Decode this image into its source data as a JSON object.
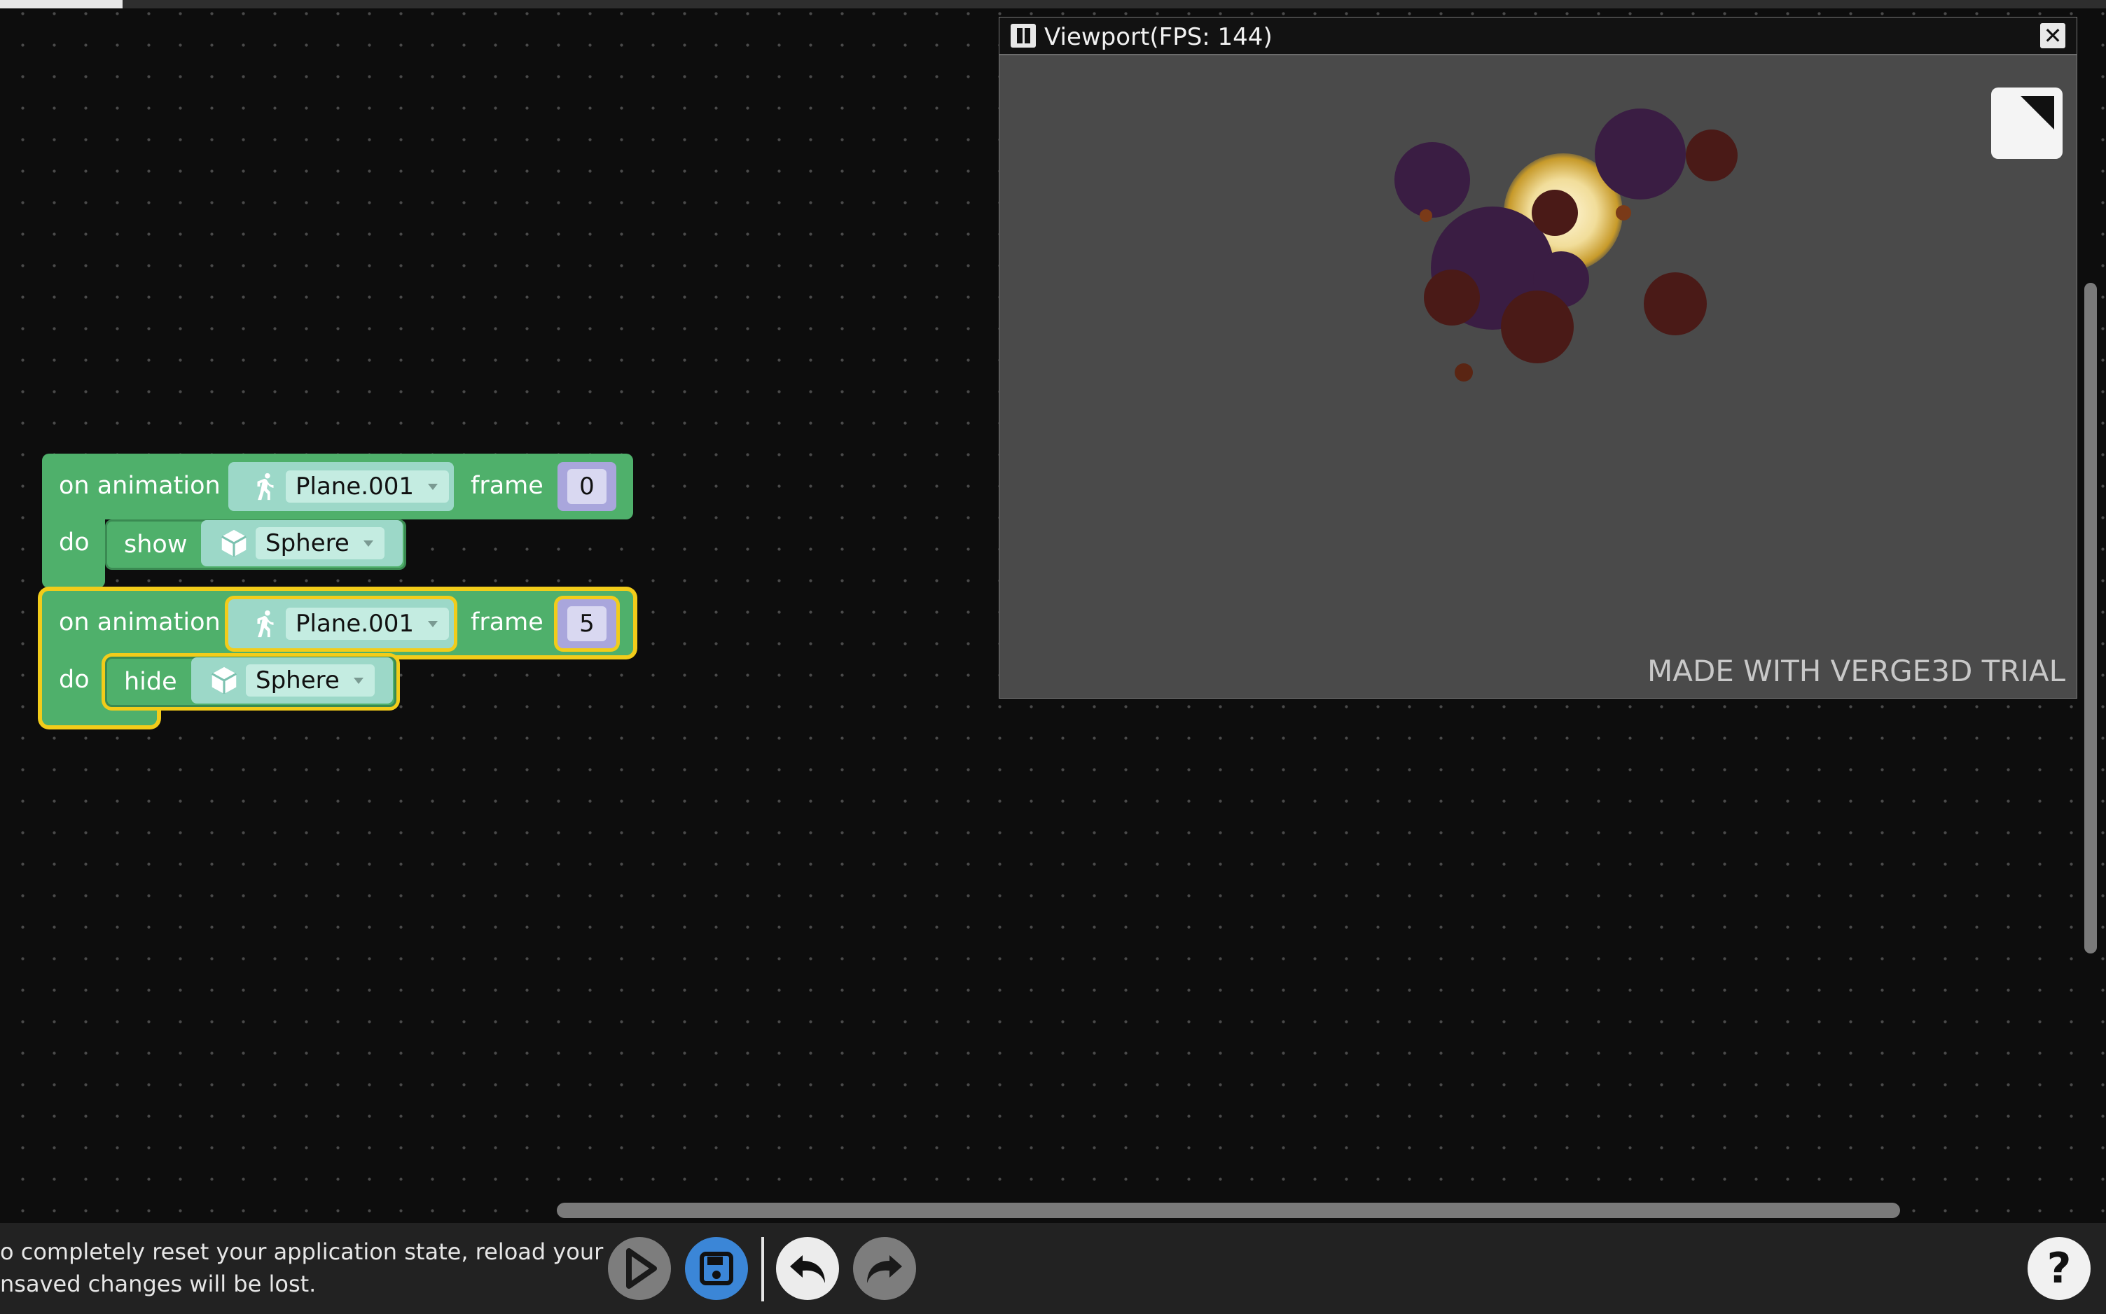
{
  "workspace": {
    "blocks": [
      {
        "event_label": "on animation",
        "object": "Plane.001",
        "frame_label": "frame",
        "frame_value": "0",
        "do_label": "do",
        "action": "show",
        "target": "Sphere"
      },
      {
        "event_label": "on animation",
        "object": "Plane.001",
        "frame_label": "frame",
        "frame_value": "5",
        "do_label": "do",
        "action": "hide",
        "target": "Sphere"
      }
    ]
  },
  "viewport": {
    "title": "Viewport(FPS: 144)",
    "close_glyph": "✕",
    "watermark": "MADE WITH VERGE3D TRIAL"
  },
  "bottom_bar": {
    "notice_line1": "o completely reset your application state, reload your",
    "notice_line2": "nsaved changes will be lost.",
    "help_glyph": "?"
  },
  "colors": {
    "block_green": "#4fb06b",
    "selection_yellow": "#f2cc1a",
    "save_blue": "#3b86d7"
  }
}
